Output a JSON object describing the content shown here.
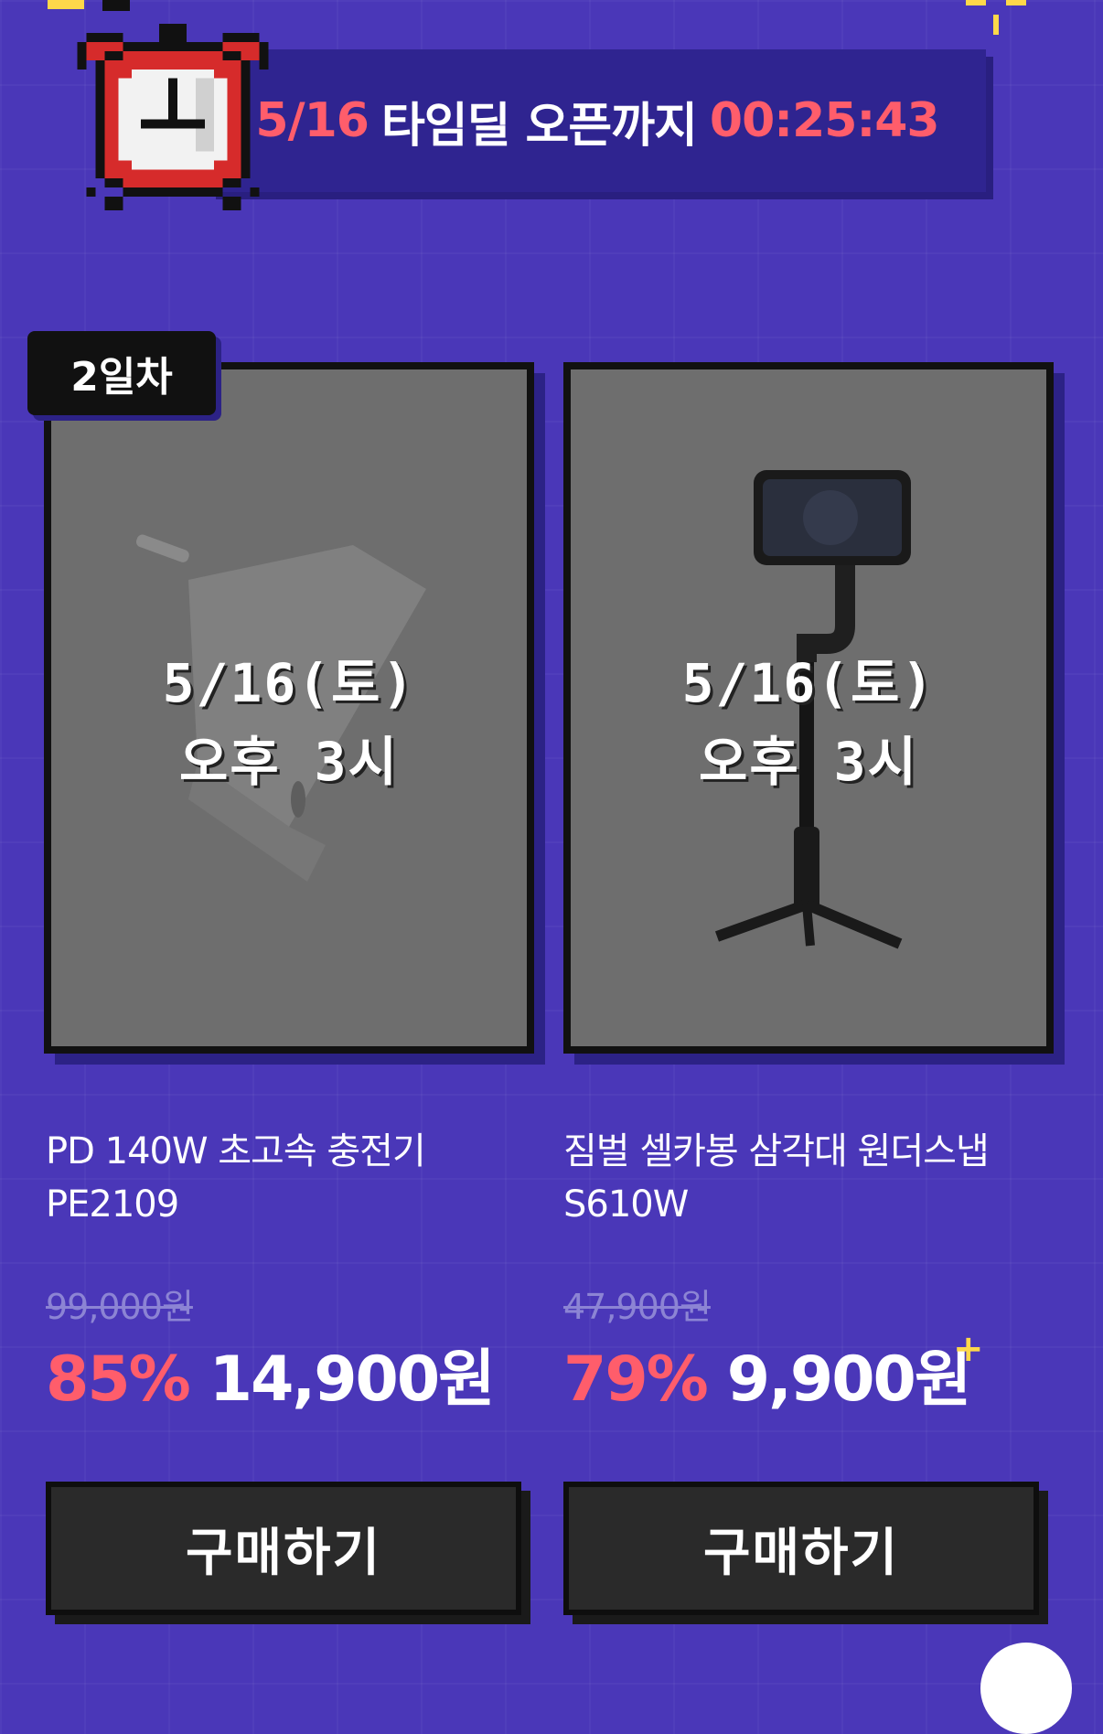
{
  "timer": {
    "date": "5/16",
    "label": "타임딜 오픈까지",
    "countdown": "00:25:43"
  },
  "products": [
    {
      "day_badge": "2일차",
      "open_date": "5/16(토)",
      "open_time": "오후 3시",
      "title_line1": "PD 140W 초고속 충전기",
      "title_line2": "PE2109",
      "original_price": "99,000원",
      "discount": "85%",
      "price": "14,900원",
      "buy_label": "구매하기"
    },
    {
      "open_date": "5/16(토)",
      "open_time": "오후 3시",
      "title_line1": "짐벌 셀카봉 삼각대 원더스냅",
      "title_line2": "S610W",
      "original_price": "47,900원",
      "discount": "79%",
      "price": "9,900원",
      "buy_label": "구매하기"
    }
  ],
  "plus_sign": "+",
  "colors": {
    "background": "#4a37b8",
    "timer_bar": "#2f2490",
    "accent_red": "#ff5d6b",
    "card_bg": "#6e6e6e",
    "button_bg": "#2a2a2a"
  },
  "icons": [
    "alarm-clock-icon",
    "charger-image",
    "gimbal-tripod-image"
  ]
}
